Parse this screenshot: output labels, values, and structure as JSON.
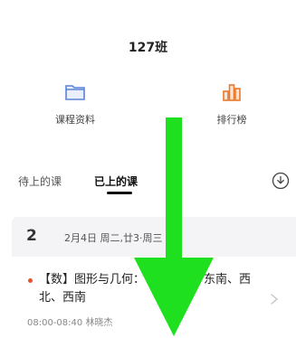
{
  "header": {
    "class_name": "127班"
  },
  "quick_actions": [
    {
      "label": "课程资料",
      "icon": "folder-icon",
      "color": "#5b84d8"
    },
    {
      "label": "排行榜",
      "icon": "ranking-icon",
      "color": "#e8792e"
    }
  ],
  "tabs": [
    {
      "label": "待上的课",
      "active": false
    },
    {
      "label": "已上的课",
      "active": true
    }
  ],
  "download_icon": "download-circle-icon",
  "lesson_group": {
    "number": "2",
    "date": "2月4日 周二,廿3·周三"
  },
  "lesson": {
    "title": "【数】图形与几何：认识东北、东南、西北、西南",
    "time": "08:00-08:40",
    "teacher": "林晓杰"
  },
  "overlay": {
    "icon": "green-down-arrow",
    "color": "#1ee01e"
  }
}
